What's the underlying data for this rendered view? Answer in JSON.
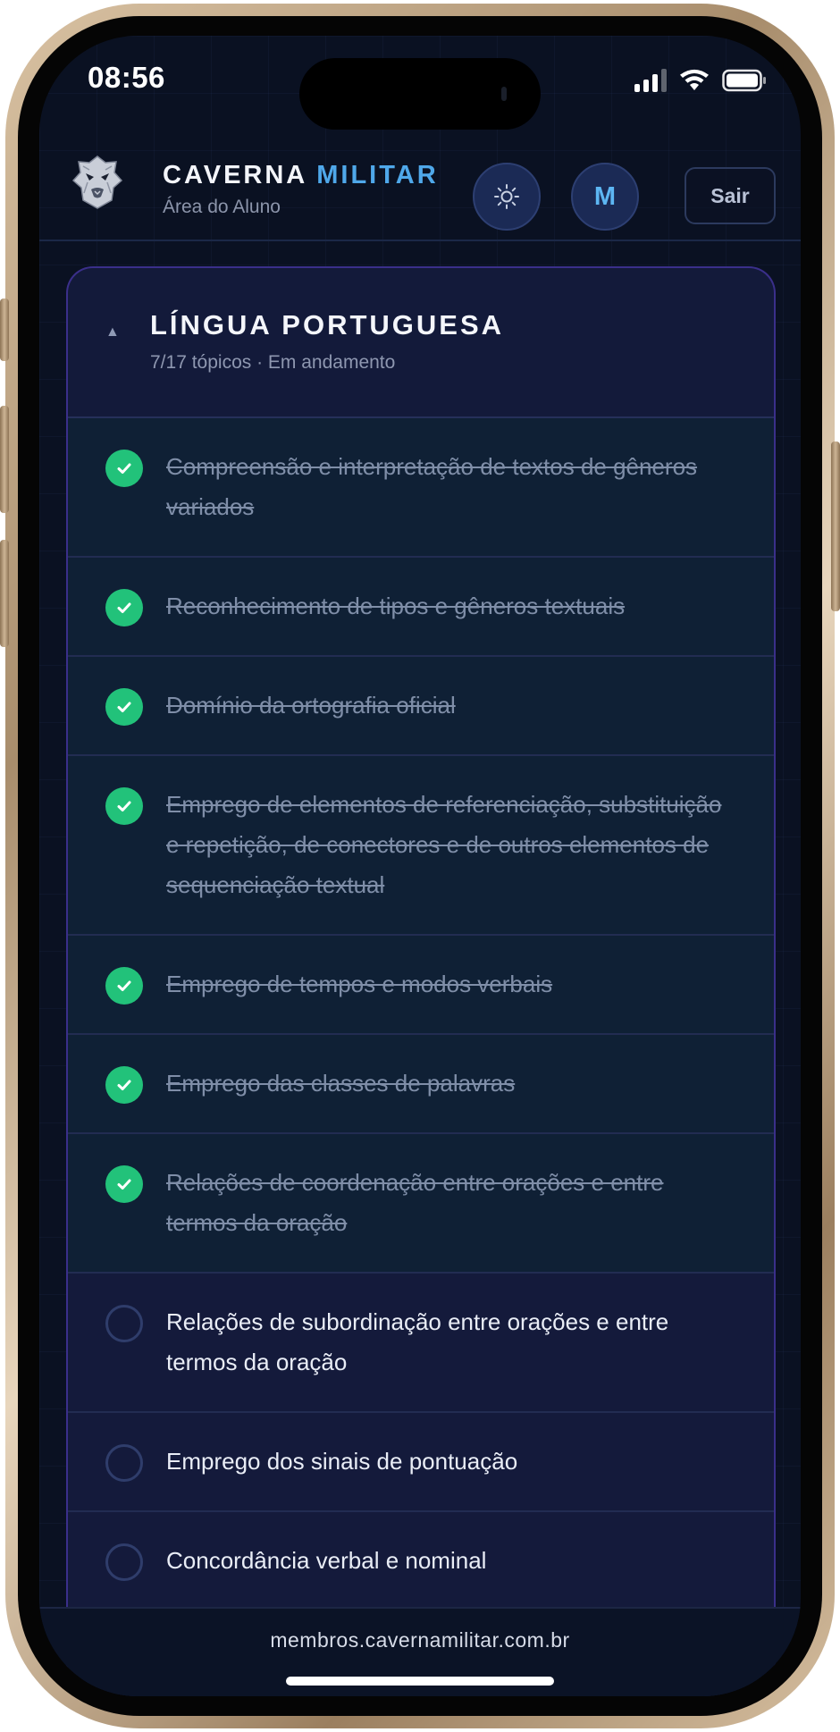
{
  "status_bar": {
    "time": "08:56"
  },
  "header": {
    "brand_part1": "CAVERNA",
    "brand_part2": "MILITAR",
    "subtitle": "Área do Aluno",
    "avatar_initial": "M",
    "logout_label": "Sair",
    "logo_icon": "lion-logo-icon",
    "theme_icon": "sun-icon"
  },
  "card": {
    "title": "LÍNGUA PORTUGUESA",
    "meta": "7/17 tópicos · Em andamento",
    "topics": [
      {
        "label": "Compreensão e interpretação de textos de gêneros variados",
        "done": true
      },
      {
        "label": "Reconhecimento de tipos e gêneros textuais",
        "done": true
      },
      {
        "label": "Domínio da ortografia oficial",
        "done": true
      },
      {
        "label": "Emprego de elementos de referenciação, substituição e repetição, de conectores e de outros elementos de sequenciação textual",
        "done": true
      },
      {
        "label": "Emprego de tempos e modos verbais",
        "done": true
      },
      {
        "label": "Emprego das classes de palavras",
        "done": true
      },
      {
        "label": "Relações de coordenação entre orações e entre termos da oração",
        "done": true
      },
      {
        "label": "Relações de subordinação entre orações e entre termos da oração",
        "done": false
      },
      {
        "label": "Emprego dos sinais de pontuação",
        "done": false
      },
      {
        "label": "Concordância verbal e nominal",
        "done": false
      }
    ]
  },
  "browser": {
    "url": "membros.cavernamilitar.com.br"
  },
  "colors": {
    "accent_blue": "#4fa8ea",
    "done_green": "#22c27a",
    "card_border": "#3a2f8a"
  }
}
